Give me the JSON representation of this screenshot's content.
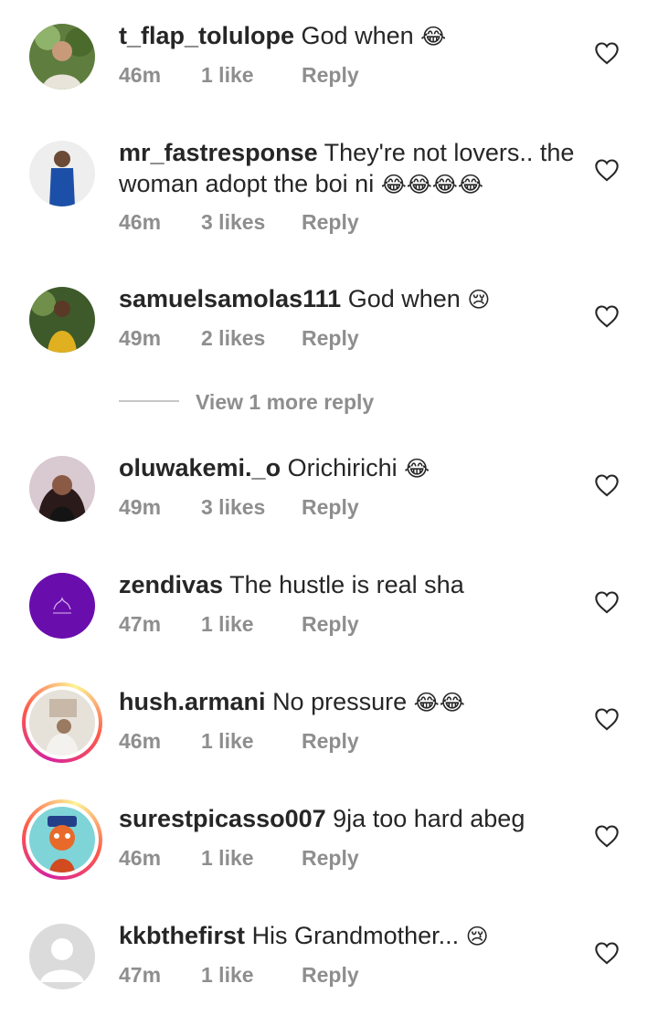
{
  "comments": [
    {
      "username": "t_flap_tolulope",
      "text": "God when",
      "emoji": "😂",
      "time": "46m",
      "likes": "1 like",
      "reply": "Reply"
    },
    {
      "username": "mr_fastresponse",
      "text": "They're not lovers.. the woman adopt the boi ni",
      "emoji": "😂😂😂😂",
      "time": "46m",
      "likes": "3 likes",
      "reply": "Reply"
    },
    {
      "username": "samuelsamolas111",
      "text": "God when",
      "emoji": "😢",
      "time": "49m",
      "likes": "2 likes",
      "reply": "Reply"
    },
    {
      "username": "oluwakemi._o",
      "text": "Orichirichi",
      "emoji": "😂",
      "time": "49m",
      "likes": "3 likes",
      "reply": "Reply"
    },
    {
      "username": "zendivas",
      "text": "The hustle is real sha",
      "emoji": "",
      "time": "47m",
      "likes": "1 like",
      "reply": "Reply"
    },
    {
      "username": "hush.armani",
      "text": "No pressure",
      "emoji": "😂😂",
      "time": "46m",
      "likes": "1 like",
      "reply": "Reply"
    },
    {
      "username": "surestpicasso007",
      "text": "9ja too hard abeg",
      "emoji": "",
      "time": "46m",
      "likes": "1 like",
      "reply": "Reply"
    },
    {
      "username": "kkbthefirst",
      "text": "His Grandmother...",
      "emoji": "😢",
      "time": "47m",
      "likes": "1 like",
      "reply": "Reply"
    }
  ],
  "view_more_replies": "View 1 more reply",
  "colors": {
    "text": "#262626",
    "meta": "#8e8e8e",
    "zendivas_avatar": "#6a0dad"
  },
  "icons": {
    "like": "heart-outline-icon"
  }
}
